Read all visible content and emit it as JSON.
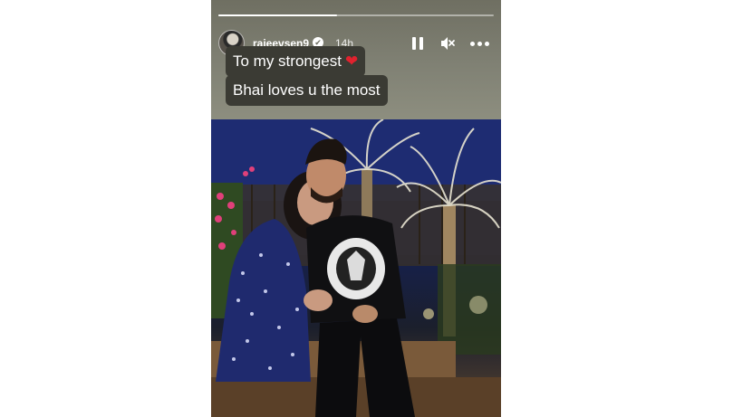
{
  "story": {
    "progress_fraction": 0.43,
    "username": "rajeevsen9",
    "verified_mark": "✔",
    "timestamp": "14h",
    "caption_line1": "To my strongest",
    "caption_heart": "❤",
    "caption_line2": "Bhai loves u the most"
  },
  "icons": {
    "avatar": "profile-avatar",
    "verified": "verified-badge-icon",
    "pause": "pause-icon",
    "mute": "mute-icon",
    "more": "more-options-icon"
  },
  "colors": {
    "caption_bg": "#3b3b34",
    "header_bg": "#7c7c6e",
    "heart": "#e0222e"
  }
}
